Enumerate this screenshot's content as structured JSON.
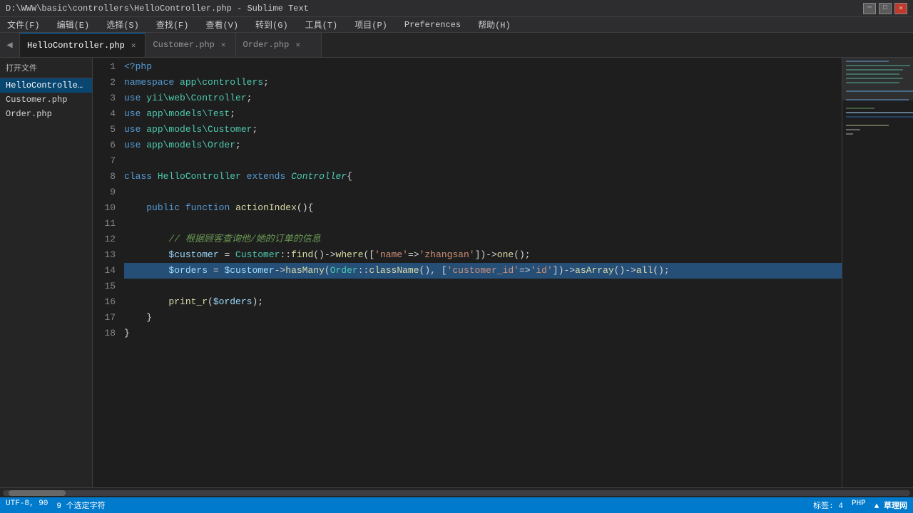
{
  "window": {
    "title": "D:\\WWW\\basic\\controllers\\HelloController.php - Sublime Text",
    "controls": [
      "minimize",
      "maximize",
      "close"
    ]
  },
  "menu": {
    "items": [
      "文件(F)",
      "编辑(E)",
      "选择(S)",
      "查找(F)",
      "查看(V)",
      "转到(G)",
      "工具(T)",
      "项目(P)",
      "Preferences",
      "帮助(H)"
    ]
  },
  "tabs": [
    {
      "label": "HelloController.php",
      "active": true
    },
    {
      "label": "Customer.php",
      "active": false
    },
    {
      "label": "Order.php",
      "active": false
    }
  ],
  "sidebar": {
    "header": "打开文件",
    "items": [
      {
        "label": "HelloController.php",
        "active": true
      },
      {
        "label": "Customer.php",
        "active": false
      },
      {
        "label": "Order.php",
        "active": false
      }
    ]
  },
  "status": {
    "encoding": "UTF-8, 90",
    "selection": "9 个选定字符",
    "line_col": "标签: 4",
    "syntax": "PHP"
  },
  "lines": [
    {
      "num": 1,
      "content": "<?php",
      "type": "normal"
    },
    {
      "num": 2,
      "content": "namespace app\\controllers;",
      "type": "normal"
    },
    {
      "num": 3,
      "content": "use yii\\web\\Controller;",
      "type": "normal"
    },
    {
      "num": 4,
      "content": "use app\\models\\Test;",
      "type": "normal"
    },
    {
      "num": 5,
      "content": "use app\\models\\Customer;",
      "type": "normal"
    },
    {
      "num": 6,
      "content": "use app\\models\\Order;",
      "type": "normal"
    },
    {
      "num": 7,
      "content": "",
      "type": "normal"
    },
    {
      "num": 8,
      "content": "class HelloController extends Controller{",
      "type": "normal"
    },
    {
      "num": 9,
      "content": "",
      "type": "normal"
    },
    {
      "num": 10,
      "content": "    public function actionIndex(){",
      "type": "normal"
    },
    {
      "num": 11,
      "content": "",
      "type": "normal"
    },
    {
      "num": 12,
      "content": "        // 根据顾客查询他/她的订单的信息",
      "type": "comment"
    },
    {
      "num": 13,
      "content": "        $customer = Customer::find()->where(['name'=>'zhangsan'])->one();",
      "type": "normal"
    },
    {
      "num": 14,
      "content": "        $orders = $customer->hasMany(Order::className(), ['customer_id'=>'id'])->asArray()->all();",
      "type": "selected"
    },
    {
      "num": 15,
      "content": "",
      "type": "normal"
    },
    {
      "num": 16,
      "content": "        print_r($orders);",
      "type": "normal"
    },
    {
      "num": 17,
      "content": "    }",
      "type": "normal"
    },
    {
      "num": 18,
      "content": "}",
      "type": "normal"
    }
  ]
}
